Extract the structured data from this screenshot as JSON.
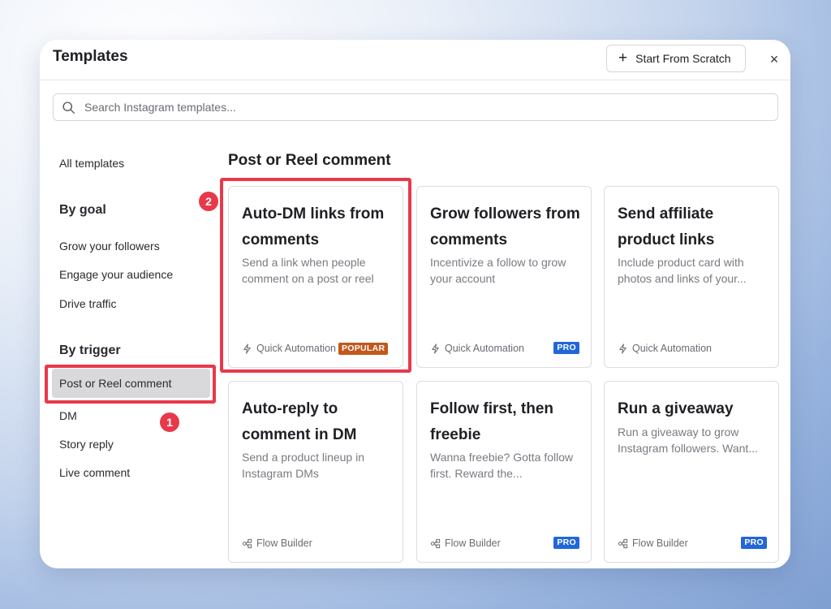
{
  "modal": {
    "title": "Templates",
    "start_from_scratch": "Start From Scratch",
    "close": "×"
  },
  "search": {
    "placeholder": "Search Instagram templates..."
  },
  "sidebar": {
    "all_templates": "All templates",
    "by_goal": "By goal",
    "goal_items": [
      "Grow your followers",
      "Engage your audience",
      "Drive traffic"
    ],
    "by_trigger": "By trigger",
    "trigger_items": [
      "Post or Reel comment",
      "DM",
      "Story reply",
      "Live comment"
    ],
    "active_item": "Post or Reel comment"
  },
  "annotations": {
    "step1": "1",
    "step2": "2",
    "color": "#e8394b"
  },
  "main": {
    "section_title": "Post or Reel comment",
    "cards": [
      {
        "title": "Auto-DM links from comments",
        "description": "Send a link when people comment on a post or reel",
        "footer": "Quick Automation",
        "footer_icon": "lightning-icon",
        "badge": "POPULAR"
      },
      {
        "title": "Grow followers from comments",
        "description": "Incentivize a follow to grow your account",
        "footer": "Quick Automation",
        "footer_icon": "lightning-icon",
        "badge": "PRO"
      },
      {
        "title": "Send affiliate product links",
        "description": "Include product card with photos and links of your...",
        "footer": "Quick Automation",
        "footer_icon": "lightning-icon",
        "badge": ""
      },
      {
        "title": "Auto-reply to comment in DM",
        "description": "Send a product lineup in Instagram DMs",
        "footer": "Flow Builder",
        "footer_icon": "flow-icon",
        "badge": ""
      },
      {
        "title": "Follow first, then freebie",
        "description": "Wanna freebie? Gotta follow first. Reward the...",
        "footer": "Flow Builder",
        "footer_icon": "flow-icon",
        "badge": "PRO"
      },
      {
        "title": "Run a giveaway",
        "description": "Run a giveaway to grow Instagram followers. Want...",
        "footer": "Flow Builder",
        "footer_icon": "flow-icon",
        "badge": "PRO"
      }
    ]
  },
  "colors": {
    "popular_badge": "#c2581c",
    "pro_badge": "#2266d9",
    "active_sidebar": "#d9d9db"
  }
}
